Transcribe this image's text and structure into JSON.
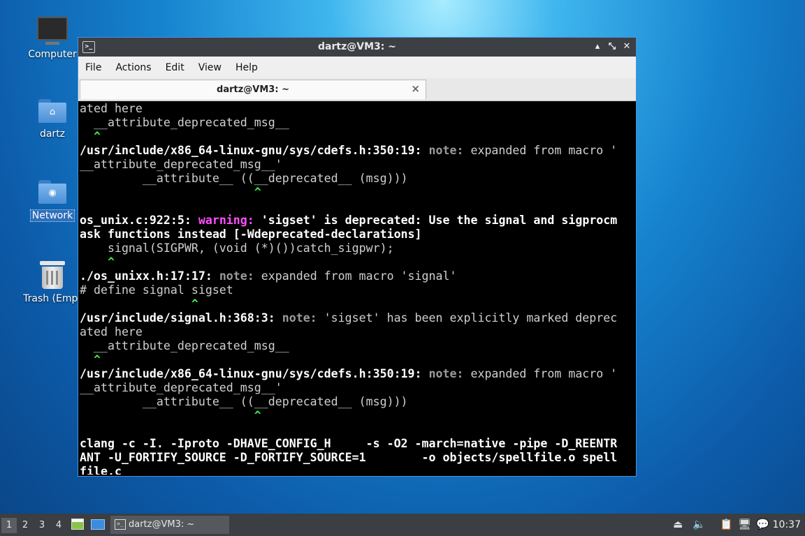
{
  "desktop": {
    "icons": [
      {
        "label": "Computer"
      },
      {
        "label": "dartz"
      },
      {
        "label": "Network"
      },
      {
        "label": "Trash (Empt"
      }
    ]
  },
  "window": {
    "title": "dartz@VM3: ~",
    "menu": [
      "File",
      "Actions",
      "Edit",
      "View",
      "Help"
    ],
    "tab_label": "dartz@VM3: ~",
    "controls": {
      "minimize": "▴",
      "maximize": "⤡",
      "close": "✕"
    }
  },
  "terminal": {
    "lines": [
      [
        {
          "t": "ated here"
        }
      ],
      [
        {
          "t": "  __attribute_deprecated_msg__"
        }
      ],
      [
        {
          "t": "  ^",
          "c": "caret"
        }
      ],
      [
        {
          "t": "/usr/include/x86_64-linux-gnu/sys/cdefs.h:350:19: ",
          "c": "b"
        },
        {
          "t": "note:",
          "c": "note"
        },
        {
          "t": " expanded from macro '"
        }
      ],
      [
        {
          "t": "__attribute_deprecated_msg__'"
        }
      ],
      [
        {
          "t": "         __attribute__ ((__deprecated__ (msg)))"
        }
      ],
      [
        {
          "t": "                         ^",
          "c": "caret"
        }
      ],
      [
        {
          "t": ""
        }
      ],
      [
        {
          "t": "os_unix.c:922:5: ",
          "c": "b"
        },
        {
          "t": "warning:",
          "c": "warn"
        },
        {
          "t": " 'sigset' is deprecated: Use the signal and sigprocm",
          "c": "b"
        }
      ],
      [
        {
          "t": "ask functions instead [-Wdeprecated-declarations]",
          "c": "b"
        }
      ],
      [
        {
          "t": "    signal(SIGPWR, (void (*)())catch_sigpwr);"
        }
      ],
      [
        {
          "t": "    ^",
          "c": "caret"
        }
      ],
      [
        {
          "t": "./os_unixx.h:17:17: ",
          "c": "b"
        },
        {
          "t": "note:",
          "c": "note"
        },
        {
          "t": " expanded from macro 'signal'"
        }
      ],
      [
        {
          "t": "# define signal sigset"
        }
      ],
      [
        {
          "t": "                ^",
          "c": "caret"
        }
      ],
      [
        {
          "t": "/usr/include/signal.h:368:3: ",
          "c": "b"
        },
        {
          "t": "note:",
          "c": "note"
        },
        {
          "t": " 'sigset' has been explicitly marked deprec"
        }
      ],
      [
        {
          "t": "ated here"
        }
      ],
      [
        {
          "t": "  __attribute_deprecated_msg__"
        }
      ],
      [
        {
          "t": "  ^",
          "c": "caret"
        }
      ],
      [
        {
          "t": "/usr/include/x86_64-linux-gnu/sys/cdefs.h:350:19: ",
          "c": "b"
        },
        {
          "t": "note:",
          "c": "note"
        },
        {
          "t": " expanded from macro '"
        }
      ],
      [
        {
          "t": "__attribute_deprecated_msg__'"
        }
      ],
      [
        {
          "t": "         __attribute__ ((__deprecated__ (msg)))"
        }
      ],
      [
        {
          "t": "                         ^",
          "c": "caret"
        }
      ],
      [
        {
          "t": ""
        }
      ],
      [
        {
          "t": "clang -c -I. -Iproto -DHAVE_CONFIG_H     -s -O2 -march=native -pipe -D_REENTR",
          "c": "b"
        }
      ],
      [
        {
          "t": "ANT -U_FORTIFY_SOURCE -D_FORTIFY_SOURCE=1        -o objects/spellfile.o spell",
          "c": "b"
        }
      ],
      [
        {
          "t": "file.c",
          "c": "b"
        }
      ]
    ]
  },
  "taskbar": {
    "workspaces": [
      "1",
      "2",
      "3",
      "4"
    ],
    "task_label": "dartz@VM3: ~",
    "clock": "10:37",
    "tray_icons": [
      "eject-icon",
      "volume-icon",
      "clipboard-icon",
      "network-icon",
      "notification-icon"
    ]
  }
}
